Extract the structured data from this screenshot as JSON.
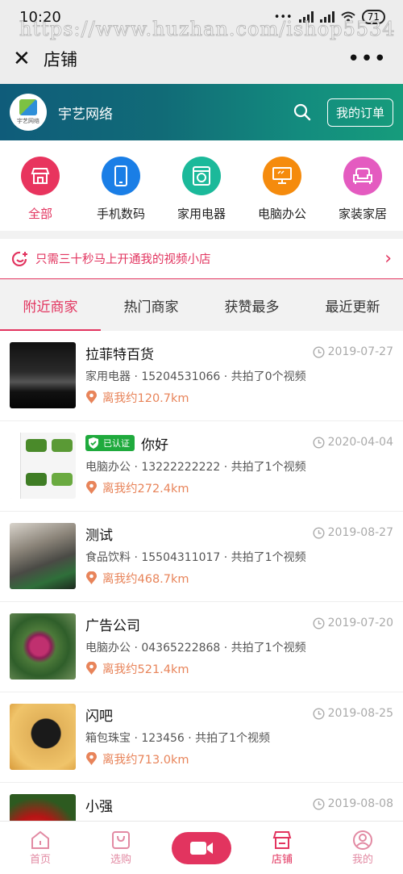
{
  "status_bar": {
    "time": "10:20",
    "battery": "71"
  },
  "watermark": "https://www.huzhan.com/ishop5534",
  "titlebar": {
    "title": "店铺"
  },
  "shop": {
    "name": "宇艺网络",
    "logo_text": "宇艺网络",
    "orders_label": "我的订单"
  },
  "categories": [
    {
      "label": "全部",
      "color": "#e8345e"
    },
    {
      "label": "手机数码",
      "color": "#1a7ee6"
    },
    {
      "label": "家用电器",
      "color": "#1bb99a"
    },
    {
      "label": "电脑办公",
      "color": "#f58b0d"
    },
    {
      "label": "家装家居",
      "color": "#e45bc0"
    }
  ],
  "promo": {
    "text": "只需三十秒马上开通我的视频小店"
  },
  "tabs": [
    "附近商家",
    "热门商家",
    "获赞最多",
    "最近更新"
  ],
  "merchants": [
    {
      "name": "拉菲特百货",
      "verified": false,
      "meta": "家用电器 · 15204531066 · 共拍了0个视频",
      "distance": "离我约120.7km",
      "date": "2019-07-27"
    },
    {
      "name": "你好",
      "verified": true,
      "verified_label": "已认证",
      "meta": "电脑办公 · 13222222222 · 共拍了1个视频",
      "distance": "离我约272.4km",
      "date": "2020-04-04"
    },
    {
      "name": "测试",
      "verified": false,
      "meta": "食品饮料 · 15504311017 · 共拍了1个视频",
      "distance": "离我约468.7km",
      "date": "2019-08-27"
    },
    {
      "name": "广告公司",
      "verified": false,
      "meta": "电脑办公 · 04365222868 · 共拍了1个视频",
      "distance": "离我约521.4km",
      "date": "2019-07-20"
    },
    {
      "name": "闪吧",
      "verified": false,
      "meta": "箱包珠宝 · 123456 · 共拍了1个视频",
      "distance": "离我约713.0km",
      "date": "2019-08-25"
    },
    {
      "name": "小强",
      "verified": false,
      "meta": "",
      "distance": "",
      "date": "2019-08-08"
    }
  ],
  "bottom_nav": {
    "home": "首页",
    "shop_pick": "选购",
    "store": "店铺",
    "mine": "我的"
  },
  "colors": {
    "accent": "#e2345f",
    "distance": "#e8845a"
  }
}
